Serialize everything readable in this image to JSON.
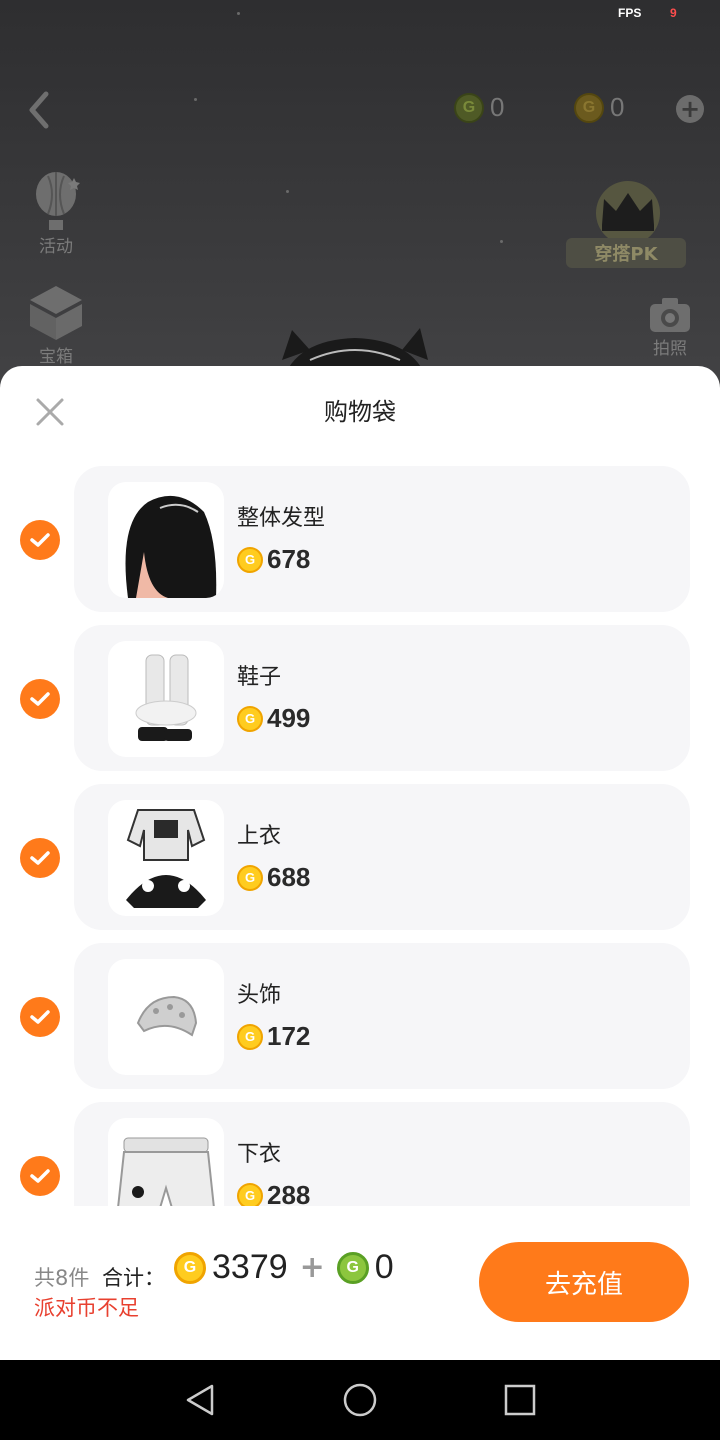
{
  "status": {
    "fps_label": "FPS",
    "fps_value": "9"
  },
  "topbar": {
    "coin_gold_count": "0",
    "coin_green_count": "0",
    "coin_gold_letter": "G",
    "coin_green_letter": "G",
    "plus_label": "+"
  },
  "side": {
    "activity_label": "活动",
    "treasure_label": "宝箱",
    "pk_label": "穿搭PK",
    "camera_label": "拍照"
  },
  "sheet": {
    "title": "购物袋",
    "items": [
      {
        "name": "整体发型",
        "price": "678",
        "checked": true
      },
      {
        "name": "鞋子",
        "price": "499",
        "checked": true
      },
      {
        "name": "上衣",
        "price": "688",
        "checked": true
      },
      {
        "name": "头饰",
        "price": "172",
        "checked": true
      },
      {
        "name": "下衣",
        "price": "288",
        "checked": true
      }
    ]
  },
  "footer": {
    "count_label": "共8件",
    "total_label": "合计：",
    "gold_total": "3379",
    "plus_sign": "+",
    "green_total": "0",
    "warning": "派对币不足",
    "recharge_label": "去充值"
  },
  "colors": {
    "accent": "#ff7a1a",
    "gold_coin": "#ffcc1f",
    "green_coin": "#8cc63e",
    "warning": "#e8402f"
  }
}
